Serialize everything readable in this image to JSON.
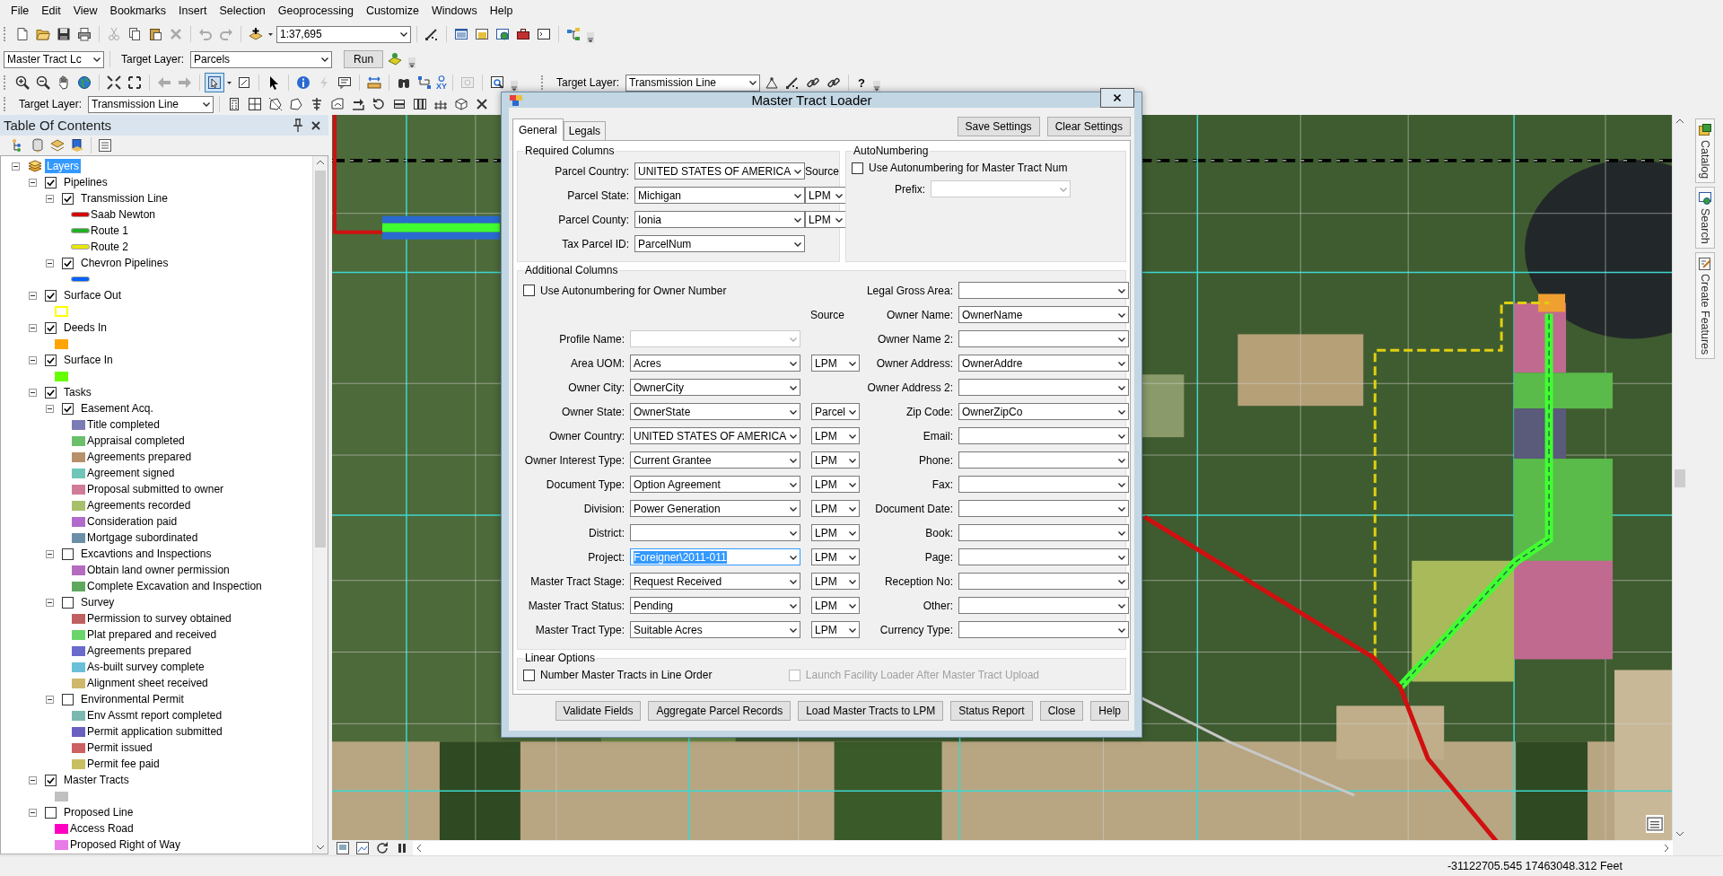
{
  "menu_bar": [
    "File",
    "Edit",
    "View",
    "Bookmarks",
    "Insert",
    "Selection",
    "Geoprocessing",
    "Customize",
    "Windows",
    "Help"
  ],
  "standard_toolbar": {
    "scale": "1:37,695"
  },
  "tract_toolbar": {
    "tool_value": "Master Tract Lc",
    "target_label": "Target Layer:",
    "target_value": "Parcels",
    "run_button": "Run"
  },
  "tools_toolbar": {
    "xy_label": "XY",
    "target_label": "Target Layer:",
    "target_value": "Transmission Line",
    "help_glyph": "?"
  },
  "editor_toolbar": {
    "target_label": "Target Layer:",
    "target_value": "Transmission Line"
  },
  "toc": {
    "title": "Table Of Contents",
    "tree": [
      {
        "kind": "frame",
        "label": "Layers",
        "selected": true,
        "expanded": true,
        "children": [
          {
            "kind": "layer",
            "label": "Pipelines",
            "checked": true,
            "expanded": true,
            "children": [
              {
                "kind": "layer",
                "label": "Transmission Line",
                "checked": true,
                "expanded": true,
                "children": [
                  {
                    "kind": "line",
                    "label": "Saab Newton",
                    "color": "#d40000"
                  },
                  {
                    "kind": "line",
                    "label": "Route 1",
                    "color": "#22b022"
                  },
                  {
                    "kind": "line",
                    "label": "Route 2",
                    "color": "#e8e800"
                  }
                ]
              },
              {
                "kind": "layer",
                "label": "Chevron Pipelines",
                "checked": true,
                "expanded": true,
                "children": [
                  {
                    "kind": "line",
                    "color": "#0060ff"
                  }
                ]
              }
            ]
          },
          {
            "kind": "layer",
            "label": "Surface Out",
            "checked": true,
            "expanded": true,
            "children": [
              {
                "kind": "outline",
                "color": "#ffff00"
              }
            ]
          },
          {
            "kind": "layer",
            "label": "Deeds In",
            "checked": true,
            "expanded": true,
            "children": [
              {
                "kind": "fill",
                "color": "#ffa500"
              }
            ]
          },
          {
            "kind": "layer",
            "label": "Surface In",
            "checked": true,
            "expanded": true,
            "children": [
              {
                "kind": "fill",
                "color": "#66ff00"
              }
            ]
          },
          {
            "kind": "layer",
            "label": "Tasks",
            "checked": true,
            "expanded": true,
            "children": [
              {
                "kind": "layer",
                "label": "Easement Acq.",
                "checked": true,
                "expanded": true,
                "children": [
                  {
                    "kind": "fill",
                    "label": "Title completed",
                    "color": "#7b7bb5"
                  },
                  {
                    "kind": "fill",
                    "label": "Appraisal completed",
                    "color": "#6bbf6b"
                  },
                  {
                    "kind": "fill",
                    "label": "Agreements prepared",
                    "color": "#b8906b"
                  },
                  {
                    "kind": "fill",
                    "label": "Agreement signed",
                    "color": "#6fc6b8"
                  },
                  {
                    "kind": "fill",
                    "label": "Proposal submitted to owner",
                    "color": "#d27b97"
                  },
                  {
                    "kind": "fill",
                    "label": "Agreements recorded",
                    "color": "#a8bf6b"
                  },
                  {
                    "kind": "fill",
                    "label": "Consideration paid",
                    "color": "#b06bcc"
                  },
                  {
                    "kind": "fill",
                    "label": "Mortgage subordinated",
                    "color": "#6b8fa8"
                  }
                ]
              },
              {
                "kind": "layer",
                "label": "Excavtions and Inspections",
                "checked": false,
                "expanded": true,
                "children": [
                  {
                    "kind": "fill",
                    "label": "Obtain land owner permission",
                    "color": "#b56bc0"
                  },
                  {
                    "kind": "fill",
                    "label": "Complete Excavation and Inspection",
                    "color": "#5fa85f"
                  }
                ]
              },
              {
                "kind": "layer",
                "label": "Survey",
                "checked": false,
                "expanded": true,
                "children": [
                  {
                    "kind": "fill",
                    "label": "Permission to survey obtained",
                    "color": "#c06060"
                  },
                  {
                    "kind": "fill",
                    "label": "Plat prepared and received",
                    "color": "#6bd46b"
                  },
                  {
                    "kind": "fill",
                    "label": "Agreements prepared",
                    "color": "#6b6bcc"
                  },
                  {
                    "kind": "fill",
                    "label": "As-built survey complete",
                    "color": "#6bc0d8"
                  },
                  {
                    "kind": "fill",
                    "label": "Alignment sheet received",
                    "color": "#cdb86b"
                  }
                ]
              },
              {
                "kind": "layer",
                "label": "Environmental Permit",
                "checked": false,
                "expanded": true,
                "children": [
                  {
                    "kind": "fill",
                    "label": "Env Assmt report completed",
                    "color": "#7bb8b0"
                  },
                  {
                    "kind": "fill",
                    "label": "Permit application submitted",
                    "color": "#6b5fc0"
                  },
                  {
                    "kind": "fill",
                    "label": "Permit issued",
                    "color": "#cd6060"
                  },
                  {
                    "kind": "fill",
                    "label": "Permit fee paid",
                    "color": "#c8c060"
                  }
                ]
              }
            ]
          },
          {
            "kind": "layer",
            "label": "Master Tracts",
            "checked": true,
            "expanded": true,
            "children": [
              {
                "kind": "fill",
                "color": "#c0c0c0"
              }
            ]
          },
          {
            "kind": "layer",
            "label": "Proposed Line",
            "checked": false,
            "expanded": true,
            "children": [
              {
                "kind": "fill",
                "label": "Access Road",
                "color": "#ff00c0"
              },
              {
                "kind": "fill",
                "label": "Proposed Right of Way",
                "color": "#e87be8"
              }
            ]
          }
        ]
      }
    ]
  },
  "dialog": {
    "title": "Master Tract Loader",
    "tabs": [
      {
        "label": "General",
        "selected": true
      },
      {
        "label": "Legals",
        "selected": false
      }
    ],
    "header_buttons": [
      "Save Settings",
      "Clear Settings"
    ],
    "required_columns": {
      "title": "Required Columns",
      "source_header": "Source",
      "fields": [
        {
          "label": "Parcel Country:",
          "value": "UNITED STATES OF AMERICA"
        },
        {
          "label": "Parcel State:",
          "value": "Michigan",
          "source": "LPM"
        },
        {
          "label": "Parcel County:",
          "value": "Ionia",
          "source": "LPM"
        },
        {
          "label": "Tax Parcel ID:",
          "value": "ParcelNum"
        }
      ]
    },
    "autonumbering": {
      "title": "AutoNumbering",
      "checkbox": {
        "label": "Use Autonumbering for Master Tract Num",
        "checked": false
      },
      "prefix_label": "Prefix:",
      "prefix_disabled": true
    },
    "additional_columns": {
      "title": "Additional Columns",
      "checkbox": {
        "label": "Use Autonumbering for Owner Number",
        "checked": false
      },
      "source_header": "Source",
      "left_fields": [
        {
          "label": "Profile Name:",
          "disabled": true,
          "highlighted": false
        },
        {
          "label": "Area UOM:",
          "value": "Acres",
          "source": "LPM",
          "disabled": false,
          "highlighted": false
        },
        {
          "label": "Owner City:",
          "value": "OwnerCity",
          "disabled": false,
          "highlighted": false
        },
        {
          "label": "Owner State:",
          "value": "OwnerState",
          "source": "Parcel",
          "disabled": false,
          "highlighted": false
        },
        {
          "label": "Owner Country:",
          "value": "UNITED STATES OF AMERICA",
          "source": "LPM",
          "disabled": false,
          "highlighted": false
        },
        {
          "label": "Owner Interest Type:",
          "value": "Current Grantee",
          "source": "LPM",
          "disabled": false,
          "highlighted": false
        },
        {
          "label": "Document Type:",
          "value": "Option Agreement",
          "source": "LPM",
          "disabled": false,
          "highlighted": false
        },
        {
          "label": "Division:",
          "value": "Power Generation",
          "source": "LPM",
          "disabled": false,
          "highlighted": false
        },
        {
          "label": "District:",
          "source": "LPM",
          "disabled": false,
          "highlighted": false
        },
        {
          "label": "Project:",
          "value": "Foreigner\\2011-011",
          "source": "LPM",
          "disabled": false,
          "highlighted": true
        },
        {
          "label": "Master Tract Stage:",
          "value": "Request Received",
          "source": "LPM",
          "disabled": false,
          "highlighted": false
        },
        {
          "label": "Master Tract Status:",
          "value": "Pending",
          "source": "LPM",
          "disabled": false,
          "highlighted": false
        },
        {
          "label": "Master Tract Type:",
          "value": "Suitable Acres",
          "source": "LPM",
          "disabled": false,
          "highlighted": false
        }
      ],
      "right_fields": [
        {
          "label": "Legal Gross Area:"
        },
        {
          "label": "Owner Name:",
          "value": "OwnerName"
        },
        {
          "label": "Owner Name 2:"
        },
        {
          "label": "Owner Address:",
          "value": "OwnerAddre"
        },
        {
          "label": "Owner Address 2:"
        },
        {
          "label": "Zip Code:",
          "value": "OwnerZipCo"
        },
        {
          "label": "Email:"
        },
        {
          "label": "Phone:"
        },
        {
          "label": "Fax:"
        },
        {
          "label": "Document Date:"
        },
        {
          "label": "Book:"
        },
        {
          "label": "Page:"
        },
        {
          "label": "Reception No:"
        },
        {
          "label": "Other:"
        },
        {
          "label": "Currency Type:"
        }
      ]
    },
    "linear_options": {
      "title": "Linear Options",
      "options": [
        {
          "label": "Number Master Tracts in Line Order",
          "checked": false,
          "disabled": false
        },
        {
          "label": "Launch Facility Loader After Master Tract Upload",
          "checked": false,
          "disabled": true
        }
      ]
    },
    "footer_buttons": [
      "Validate Fields",
      "Aggregate Parcel Records",
      "Load Master Tracts to LPM",
      "Status Report",
      "Close",
      "Help"
    ]
  },
  "side_tabs": [
    "Catalog",
    "Search",
    "Create Features"
  ],
  "status_bar": {
    "coordinates": "-31122705.545  17463048.312 Feet"
  }
}
